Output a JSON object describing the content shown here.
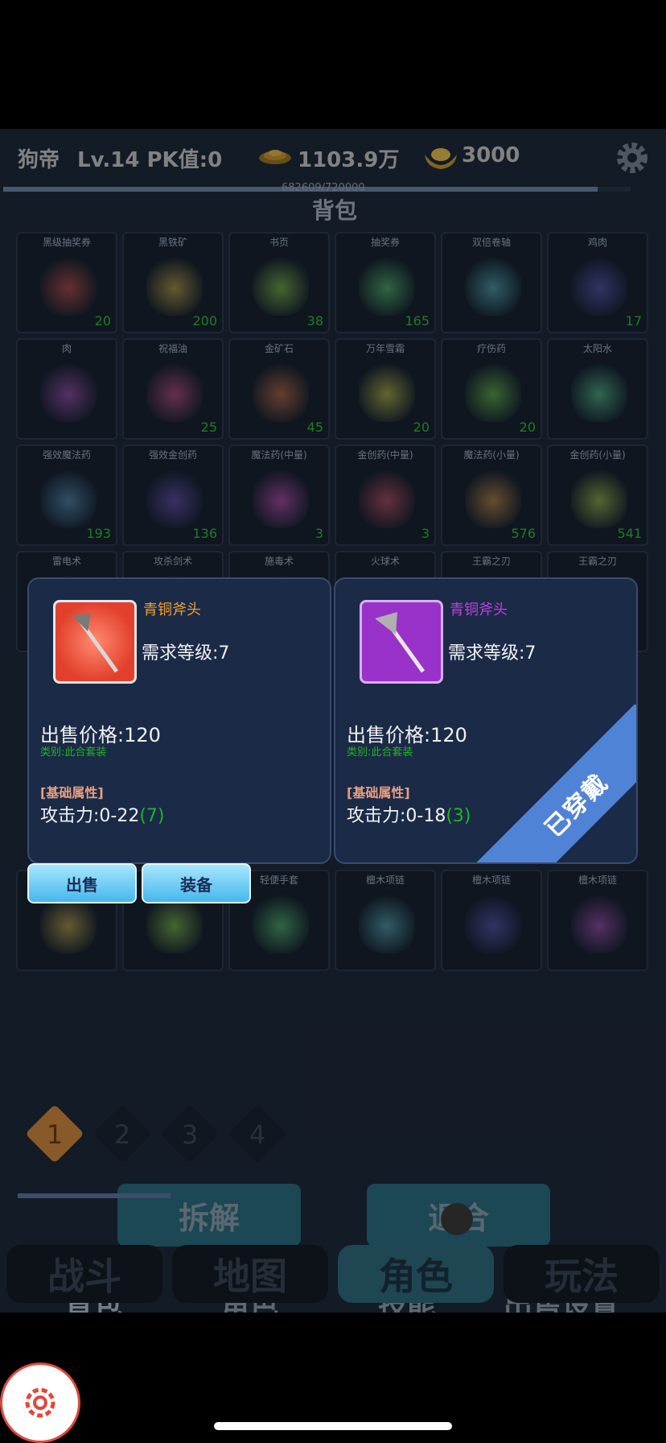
{
  "status": {
    "name": "狗帝",
    "level": "Lv.14 PK值:0",
    "coins": "1103.9万",
    "ingots": "3000",
    "exp_text": "682609/720000",
    "exp_fraction": 0.948
  },
  "bag_title": "背包",
  "items": [
    {
      "name": "黑级抽奖券",
      "qty": "20",
      "icon": "ticket-book-icon"
    },
    {
      "name": "黑铁矿",
      "qty": "200",
      "icon": "iron-ore-icon"
    },
    {
      "name": "书页",
      "qty": "38",
      "icon": "scroll-icon"
    },
    {
      "name": "抽奖券",
      "qty": "165",
      "icon": "ticket-book-icon"
    },
    {
      "name": "双倍卷轴",
      "qty": "",
      "icon": "rolled-scroll-icon"
    },
    {
      "name": "鸡肉",
      "qty": "17",
      "icon": "chicken-icon"
    },
    {
      "name": "肉",
      "qty": "",
      "icon": "meat-icon"
    },
    {
      "name": "祝福油",
      "qty": "25",
      "icon": "blue-potion-icon"
    },
    {
      "name": "金矿石",
      "qty": "45",
      "icon": "gold-ore-icon"
    },
    {
      "name": "万年雪霜",
      "qty": "20",
      "icon": "ginseng-icon"
    },
    {
      "name": "疗伤药",
      "qty": "20",
      "icon": "green-vial-icon"
    },
    {
      "name": "太阳水",
      "qty": "",
      "icon": "yellow-flask-icon"
    },
    {
      "name": "强效魔法药",
      "qty": "193",
      "icon": "purple-jar-icon"
    },
    {
      "name": "强效金创药",
      "qty": "136",
      "icon": "red-jar-icon"
    },
    {
      "name": "魔法药(中量)",
      "qty": "3",
      "icon": "blue-bottle-icon"
    },
    {
      "name": "金创药(中量)",
      "qty": "3",
      "icon": "red-bottle-icon"
    },
    {
      "name": "魔法药(小量)",
      "qty": "576",
      "icon": "small-blue-potion-icon"
    },
    {
      "name": "金创药(小量)",
      "qty": "541",
      "icon": "small-red-potion-icon"
    },
    {
      "name": "雷电术",
      "qty": "",
      "icon": "book-icon"
    },
    {
      "name": "攻杀剑术",
      "qty": "",
      "icon": "book-icon"
    },
    {
      "name": "施毒术",
      "qty": "",
      "icon": "book-icon"
    },
    {
      "name": "火球术",
      "qty": "",
      "icon": "book-icon"
    },
    {
      "name": "王霸之刃",
      "qty": "",
      "icon": "blade-icon"
    },
    {
      "name": "王霸之刃",
      "qty": "",
      "icon": "blade-icon"
    }
  ],
  "row_bottom": [
    {
      "name": "",
      "icon": "staff-icon"
    },
    {
      "name": "",
      "icon": "glove-icon"
    },
    {
      "name": "轻便手套",
      "icon": "glove-icon"
    },
    {
      "name": "檀木项链",
      "icon": "necklace-icon"
    },
    {
      "name": "檀木项链",
      "icon": "necklace-icon"
    },
    {
      "name": "檀木项链",
      "icon": "necklace-icon"
    }
  ],
  "popup_left": {
    "name": "青铜斧头",
    "name_color": "#f0a030",
    "req": "需求等级:7",
    "price": "出售价格:120",
    "type": "类别:此合套装",
    "attr_header": "[基础属性]",
    "atk": "攻击力:0-22",
    "atk_bonus": "(7)"
  },
  "popup_right": {
    "name": "青铜斧头",
    "name_color": "#c040e0",
    "req": "需求等级:7",
    "price": "出售价格:120",
    "type": "类别:此合套装",
    "attr_header": "[基础属性]",
    "atk": "攻击力:0-18",
    "atk_bonus": "(3)",
    "equipped": "已穿戴"
  },
  "buttons": {
    "sell": "出售",
    "equip": "装备",
    "dismantle": "拆解",
    "synth": "退合"
  },
  "pages": [
    "1",
    "2",
    "3",
    "4"
  ],
  "subtabs": [
    "背包",
    "角色",
    "技能",
    "出售设置"
  ],
  "nav": [
    "战斗",
    "地图",
    "角色",
    "玩法"
  ]
}
